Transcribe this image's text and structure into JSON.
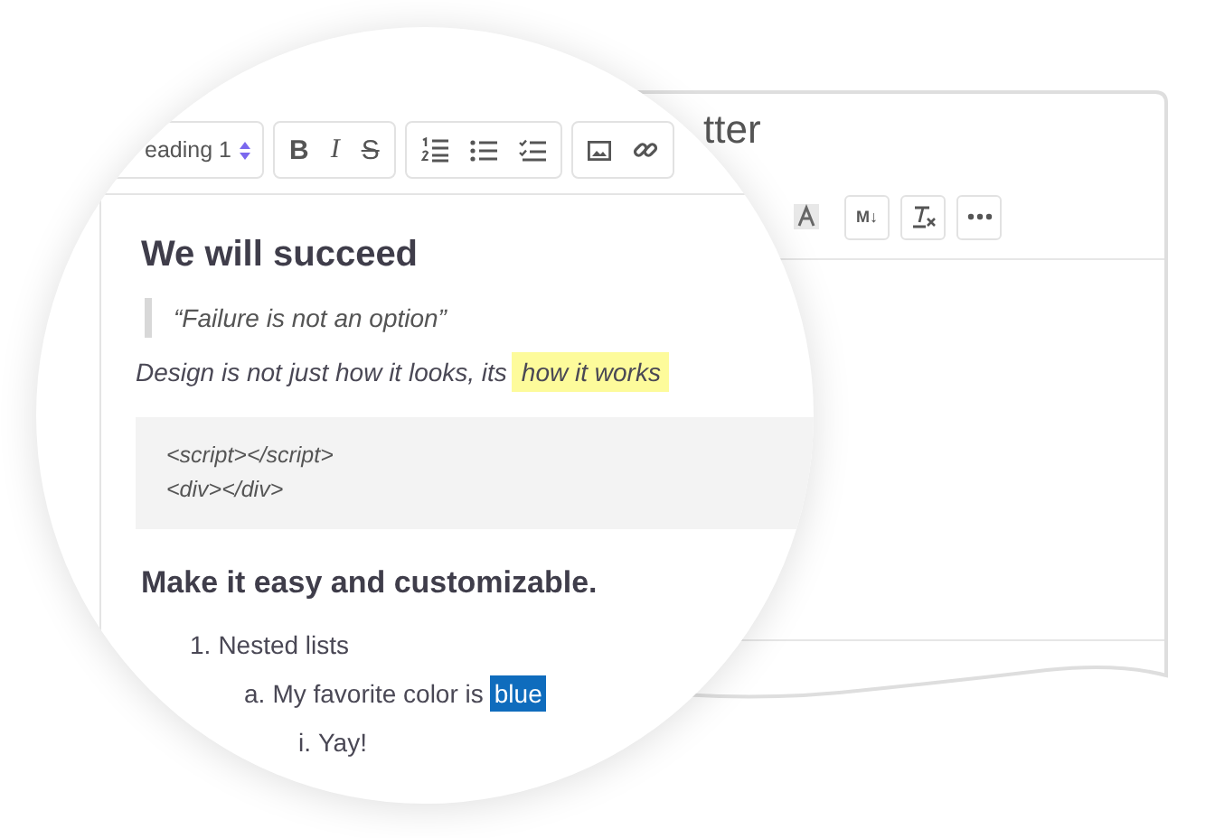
{
  "background_window": {
    "title": "tter",
    "toolbar": [
      {
        "kind": "highlight"
      },
      {
        "kind": "text",
        "label": "M↓"
      },
      {
        "kind": "clear-format"
      },
      {
        "kind": "more"
      }
    ]
  },
  "magnifier": {
    "toolbar": {
      "heading_select": "eading 1",
      "format_buttons": [
        {
          "kind": "bold",
          "label": "B"
        },
        {
          "kind": "italic",
          "label": "I"
        },
        {
          "kind": "strike",
          "label": "S"
        }
      ],
      "list_buttons": [
        {
          "kind": "numbered"
        },
        {
          "kind": "bulleted"
        },
        {
          "kind": "checklist"
        }
      ],
      "insert_buttons": [
        {
          "kind": "image"
        },
        {
          "kind": "link"
        }
      ]
    },
    "content": [
      {
        "kind": "heading",
        "text": "We will succeed"
      },
      {
        "kind": "quote",
        "text": "“Failure is not an option”"
      },
      {
        "kind": "paragraph",
        "text": "Design is not just how it looks, its",
        "highlight": "how it works"
      },
      {
        "kind": "code",
        "lines": [
          "<script></script>",
          "<div></div>"
        ]
      },
      {
        "kind": "heading",
        "text": "Make it easy and customizable."
      },
      {
        "kind": "list",
        "items": [
          {
            "marker": "1.",
            "text": "Nested lists",
            "children": [
              {
                "marker": "a.",
                "text": "My favorite color is",
                "selection": "blue",
                "children": [
                  {
                    "marker": "i.",
                    "text": "Yay!"
                  }
                ]
              }
            ]
          }
        ]
      }
    ]
  }
}
